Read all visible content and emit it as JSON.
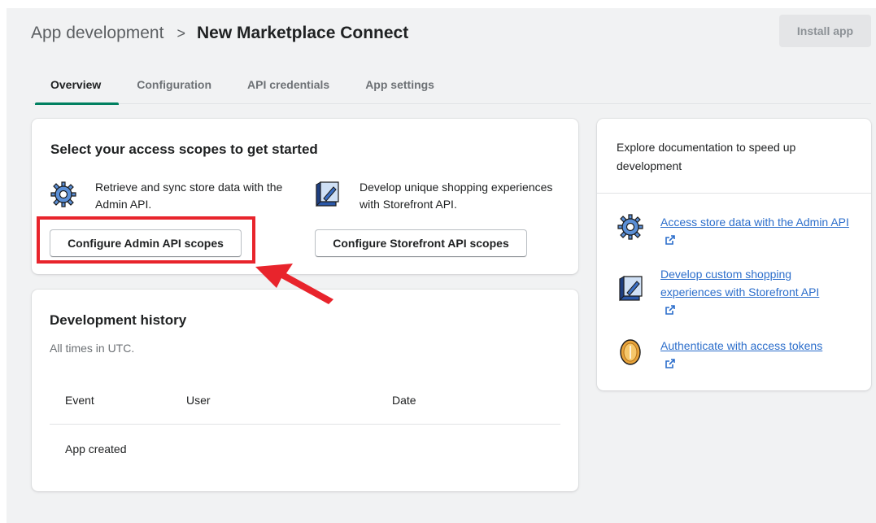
{
  "header": {
    "breadcrumb_parent": "App development",
    "breadcrumb_separator": ">",
    "app_title": "New Marketplace Connect",
    "install_label": "Install app"
  },
  "tabs": [
    {
      "label": "Overview",
      "active": true
    },
    {
      "label": "Configuration",
      "active": false
    },
    {
      "label": "API credentials",
      "active": false
    },
    {
      "label": "App settings",
      "active": false
    }
  ],
  "access_card": {
    "title": "Select your access scopes to get started",
    "admin": {
      "description": "Retrieve and sync store data with the Admin API.",
      "button_label": "Configure Admin API scopes",
      "icon": "gear-icon"
    },
    "storefront": {
      "description": "Develop unique shopping experiences with Storefront API.",
      "button_label": "Configure Storefront API scopes",
      "icon": "storefront-icon"
    }
  },
  "history_card": {
    "title": "Development history",
    "subtitle": "All times in UTC.",
    "columns": [
      "Event",
      "User",
      "Date"
    ],
    "rows": [
      {
        "event": "App created",
        "user": "",
        "date": ""
      }
    ]
  },
  "docs_card": {
    "header": "Explore documentation to speed up development",
    "links": [
      {
        "label": "Access store data with the Admin API",
        "icon": "gear-icon"
      },
      {
        "label": "Develop custom shopping experiences with Storefront API",
        "icon": "storefront-icon"
      },
      {
        "label": "Authenticate with access tokens",
        "icon": "token-coin-icon"
      }
    ]
  },
  "colors": {
    "accent": "#008060",
    "link": "#2c6ecb",
    "annotation": "#e8242c"
  }
}
